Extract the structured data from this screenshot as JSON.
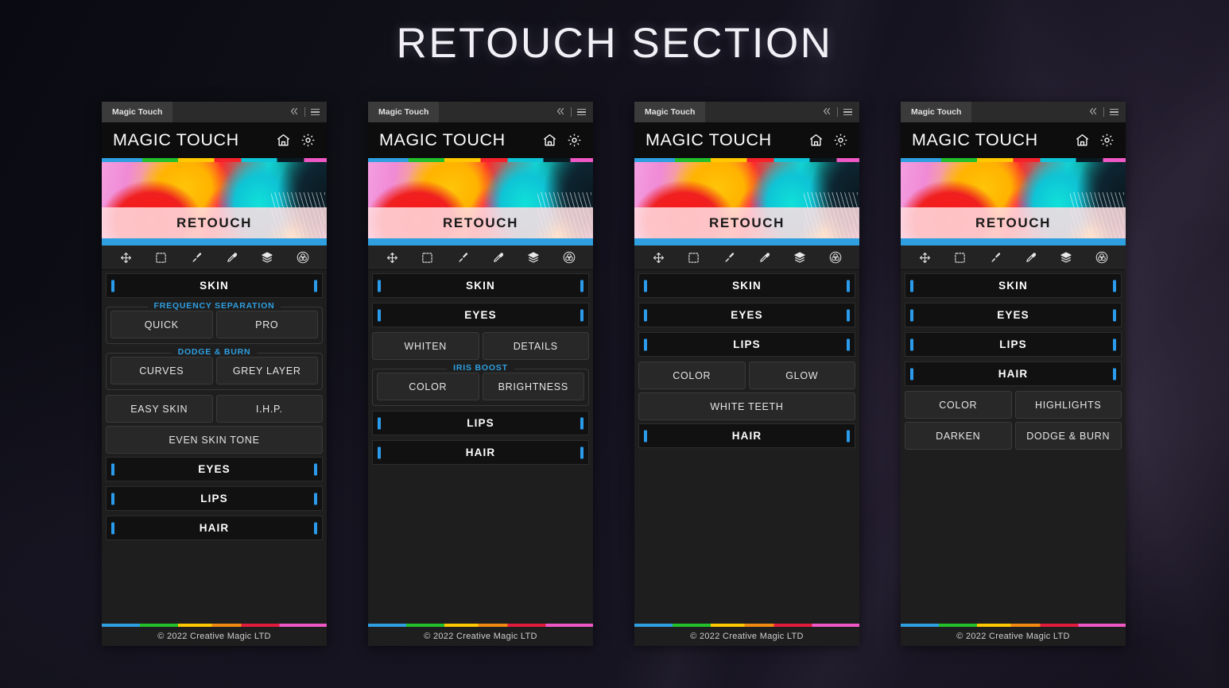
{
  "page": {
    "title": "RETOUCH SECTION",
    "background_color": "#15121c",
    "accent_color": "#2f9fe0"
  },
  "chrome": {
    "tab_label": "Magic Touch",
    "collapse_icon": "chevron-double-left-icon",
    "menu_icon": "hamburger-menu-icon"
  },
  "header": {
    "title": "MAGIC TOUCH",
    "home_icon": "home-icon",
    "settings_icon": "gear-icon"
  },
  "banner": {
    "label": "RETOUCH"
  },
  "toolbar": {
    "tools": [
      {
        "name": "move-tool",
        "icon": "move-arrows-icon"
      },
      {
        "name": "marquee-select-tool",
        "icon": "dashed-square-icon"
      },
      {
        "name": "brush-tool",
        "icon": "paintbrush-icon"
      },
      {
        "name": "eyedropper-tool",
        "icon": "eyedropper-icon"
      },
      {
        "name": "layers-tool",
        "icon": "layers-stack-icon"
      },
      {
        "name": "color-mix-tool",
        "icon": "color-circles-icon"
      }
    ]
  },
  "footer": {
    "copyright": "© 2022 Creative Magic LTD"
  },
  "panels": [
    {
      "id": "panel-skin",
      "active_section": "SKIN",
      "sections": [
        {
          "label": "SKIN",
          "expanded": true,
          "groups": [
            {
              "legend": "FREQUENCY SEPARATION",
              "rows": [
                [
                  "QUICK",
                  "PRO"
                ]
              ]
            },
            {
              "legend": "DODGE & BURN",
              "rows": [
                [
                  "CURVES",
                  "GREY LAYER"
                ]
              ]
            }
          ],
          "rows": [
            [
              "EASY SKIN",
              "I.H.P."
            ],
            [
              "EVEN SKIN TONE"
            ]
          ]
        },
        {
          "label": "EYES",
          "expanded": false
        },
        {
          "label": "LIPS",
          "expanded": false
        },
        {
          "label": "HAIR",
          "expanded": false
        }
      ]
    },
    {
      "id": "panel-eyes",
      "active_section": "EYES",
      "sections": [
        {
          "label": "SKIN",
          "expanded": false
        },
        {
          "label": "EYES",
          "expanded": true,
          "rows": [
            [
              "WHITEN",
              "DETAILS"
            ]
          ],
          "groups": [
            {
              "legend": "IRIS BOOST",
              "rows": [
                [
                  "COLOR",
                  "BRIGHTNESS"
                ]
              ]
            }
          ]
        },
        {
          "label": "LIPS",
          "expanded": false
        },
        {
          "label": "HAIR",
          "expanded": false
        }
      ]
    },
    {
      "id": "panel-lips",
      "active_section": "LIPS",
      "sections": [
        {
          "label": "SKIN",
          "expanded": false
        },
        {
          "label": "EYES",
          "expanded": false
        },
        {
          "label": "LIPS",
          "expanded": true,
          "rows": [
            [
              "COLOR",
              "GLOW"
            ],
            [
              "WHITE TEETH"
            ]
          ]
        },
        {
          "label": "HAIR",
          "expanded": false
        }
      ]
    },
    {
      "id": "panel-hair",
      "active_section": "HAIR",
      "sections": [
        {
          "label": "SKIN",
          "expanded": false
        },
        {
          "label": "EYES",
          "expanded": false
        },
        {
          "label": "LIPS",
          "expanded": false
        },
        {
          "label": "HAIR",
          "expanded": true,
          "rows": [
            [
              "COLOR",
              "HIGHLIGHTS"
            ],
            [
              "DARKEN",
              "DODGE & BURN"
            ]
          ]
        }
      ]
    }
  ]
}
